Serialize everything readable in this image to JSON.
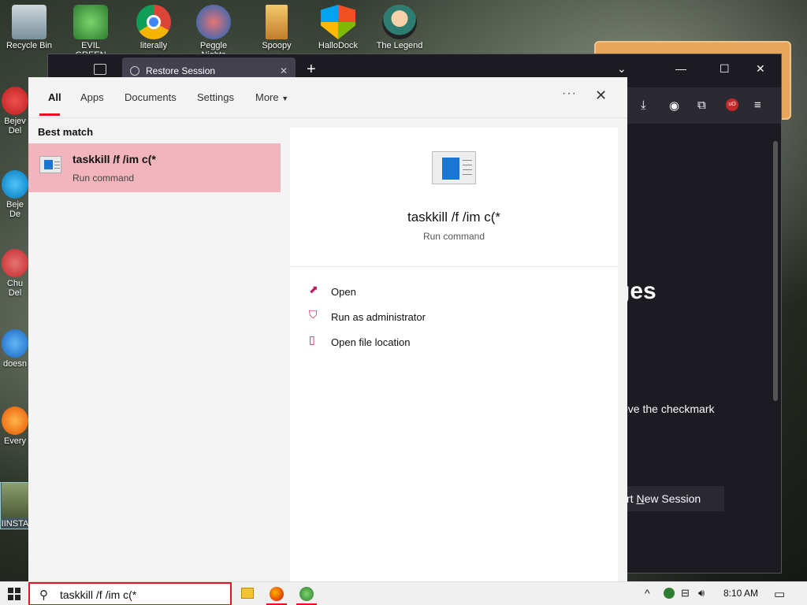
{
  "desktop": {
    "icons": [
      {
        "label": "Recycle Bin"
      },
      {
        "label": "EVIL GREEN"
      },
      {
        "label": "literally"
      },
      {
        "label": "Peggle Nights"
      },
      {
        "label": "Spoopy"
      },
      {
        "label": "HalloDock"
      },
      {
        "label": "The Legend"
      },
      {
        "label": "Bejev\nDel"
      },
      {
        "label": "Beje\nDe"
      },
      {
        "label": "Chu\nDel"
      },
      {
        "label": "doesn"
      },
      {
        "label": "Every"
      },
      {
        "label": "IINSTA"
      }
    ]
  },
  "browser": {
    "tab_title": "Restore Session",
    "content_heading": "ges",
    "content_text": "ove the checkmark",
    "button_prefix": "rt ",
    "button_underlined": "N",
    "button_rest": "ew Session"
  },
  "search": {
    "tabs": [
      "All",
      "Apps",
      "Documents",
      "Settings",
      "More"
    ],
    "best_match_label": "Best match",
    "result": {
      "title": "taskkill /f /im c(*",
      "subtitle": "Run command"
    },
    "detail": {
      "title": "taskkill /f /im c(*",
      "subtitle": "Run command"
    },
    "actions": [
      "Open",
      "Run as administrator",
      "Open file location"
    ]
  },
  "taskbar": {
    "search_value": "taskkill /f /im c(*",
    "clock": "8:10 AM"
  }
}
